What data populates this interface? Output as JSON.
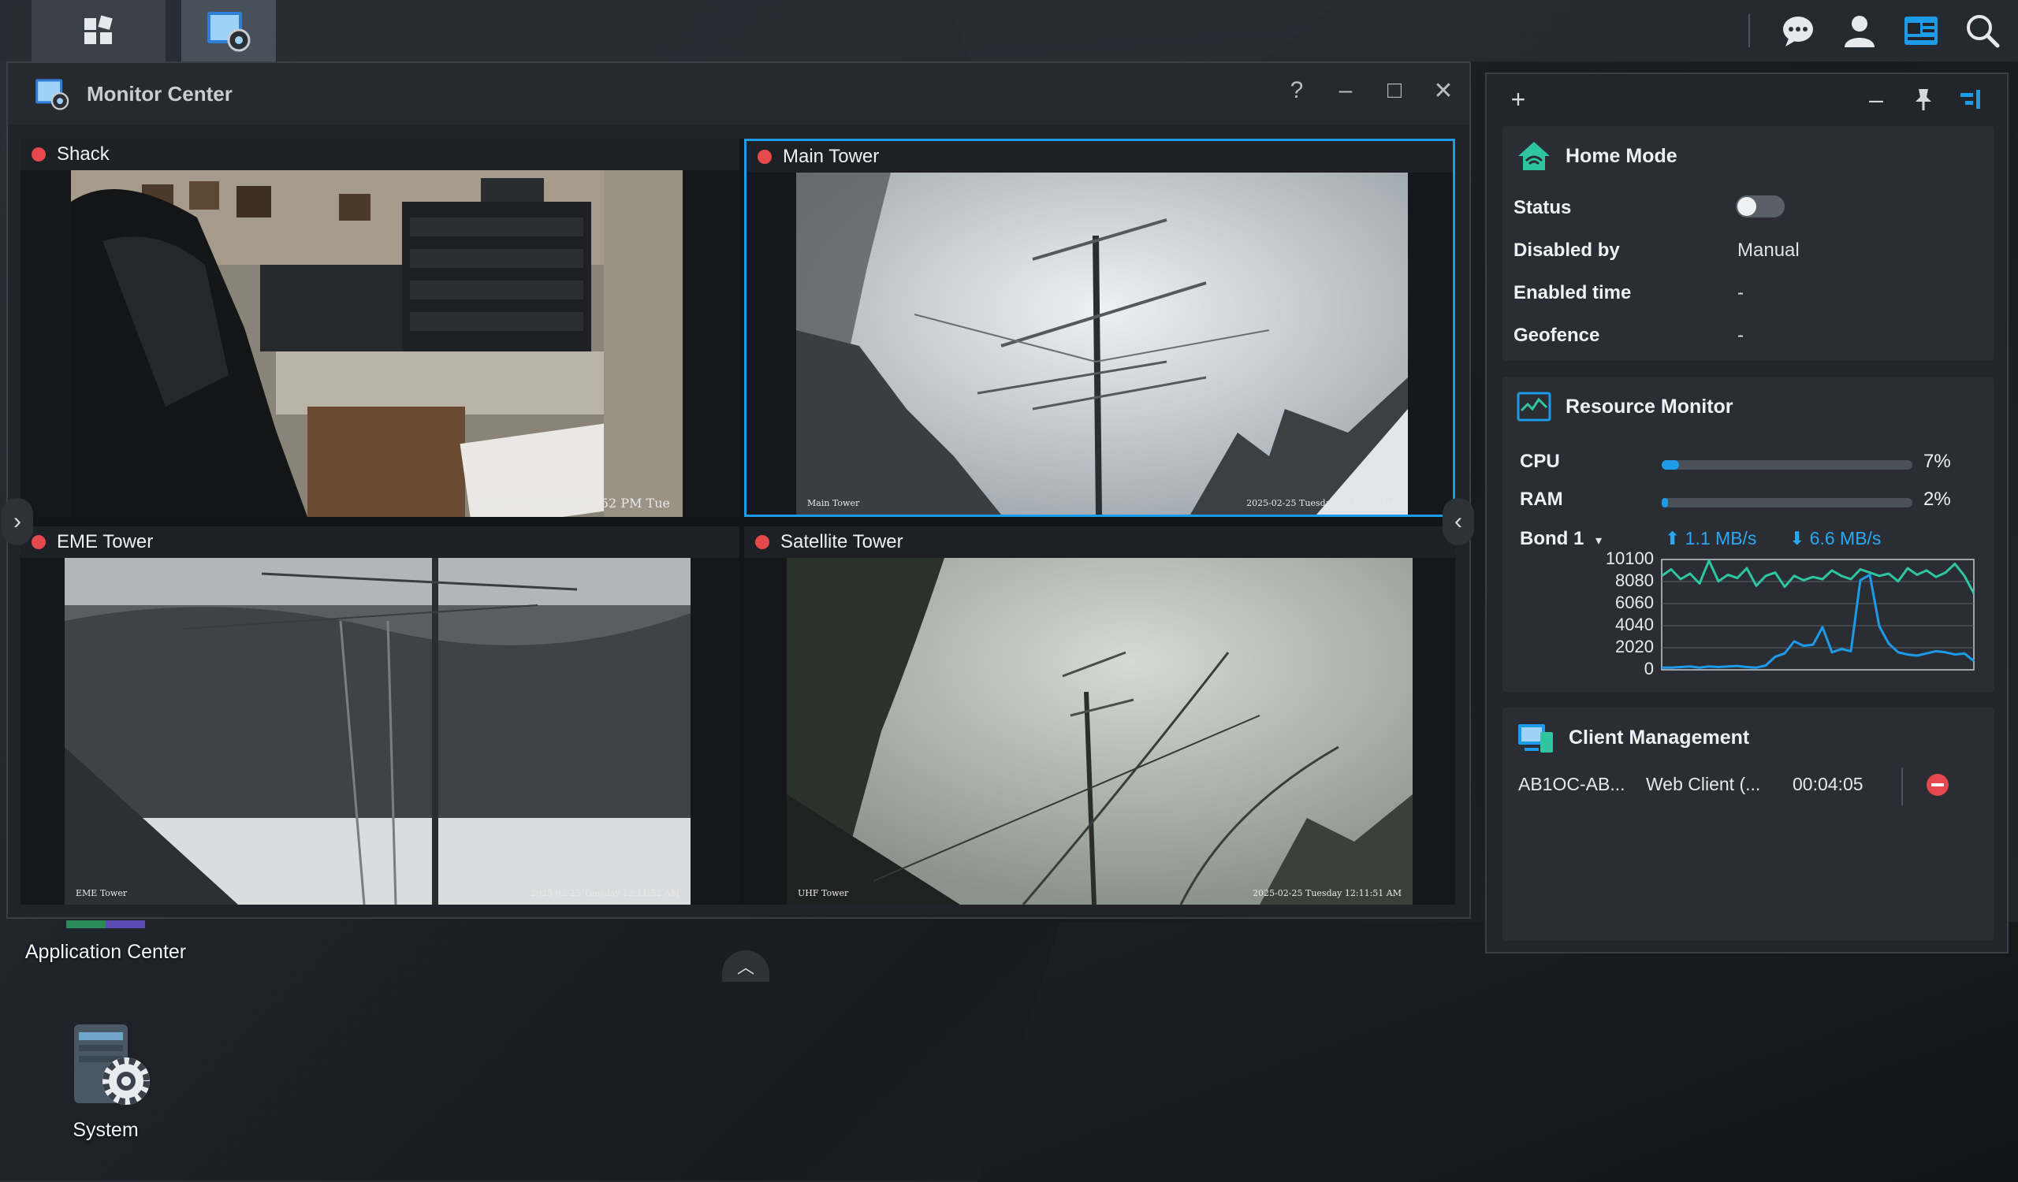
{
  "taskbar": {
    "left_icons": [
      "main-menu-icon",
      "monitor-center-icon"
    ],
    "right_icons": [
      "chat-icon",
      "user-icon",
      "widgets-icon",
      "search-icon"
    ]
  },
  "window": {
    "title": "Monitor Center",
    "controls": {
      "help": "?",
      "minimize": "–",
      "maximize": "□",
      "close": "✕"
    }
  },
  "cameras": [
    {
      "name": "Shack",
      "overlay_left": "",
      "overlay_right": "2025-02-25 12:11:52 PM Tue",
      "selected": false
    },
    {
      "name": "Main Tower",
      "overlay_left": "Main Tower",
      "overlay_right": "2025-02-25 Tuesday 12:11:48 AM",
      "selected": true
    },
    {
      "name": "EME Tower",
      "overlay_left": "EME Tower",
      "overlay_right": "2025-02-25 Tuesday 12:11:52 AM",
      "selected": false
    },
    {
      "name": "Satellite Tower",
      "overlay_left": "UHF Tower",
      "overlay_right": "2025-02-25 Tuesday 12:11:51 AM",
      "selected": false
    }
  ],
  "desktop": {
    "icons": [
      {
        "label": "Application Center",
        "icon": "application-center-icon"
      },
      {
        "label": "System",
        "icon": "system-gear-icon"
      }
    ]
  },
  "panel": {
    "home_mode": {
      "title": "Home Mode",
      "rows": [
        {
          "label": "Status",
          "value": ""
        },
        {
          "label": "Disabled by",
          "value": "Manual"
        },
        {
          "label": "Enabled time",
          "value": "-"
        },
        {
          "label": "Geofence",
          "value": "-"
        }
      ],
      "status_enabled": false
    },
    "resource_monitor": {
      "title": "Resource Monitor",
      "cpu_label": "CPU",
      "cpu_value": "7%",
      "cpu_fraction": 0.07,
      "ram_label": "RAM",
      "ram_value": "2%",
      "ram_fraction": 0.02,
      "net_label": "Bond 1",
      "upload": "1.1 MB/s",
      "download": "6.6 MB/s",
      "colors": {
        "upload": "#2ec5a0",
        "download": "#1e9be8"
      }
    },
    "client_management": {
      "title": "Client Management",
      "clients": [
        {
          "name": "AB1OC-AB...",
          "type": "Web Client (...",
          "duration": "00:04:05"
        }
      ]
    }
  },
  "chart_data": {
    "type": "line",
    "yticks": [
      "10100",
      "8080",
      "6060",
      "4040",
      "2020",
      "0"
    ],
    "ylim": [
      0,
      10100
    ],
    "grid": true,
    "series": [
      {
        "values": [
          8600,
          9200,
          8300,
          8800,
          7900,
          10000,
          8100,
          8700,
          8400,
          9300,
          7700,
          8600,
          8900,
          7600,
          8600,
          8200,
          8500,
          8300,
          9100,
          8600,
          8300,
          9200,
          8900,
          8600,
          8800,
          8100,
          9300,
          8700,
          9100,
          8500,
          8900,
          9700,
          8600,
          7000
        ]
      },
      {
        "values": [
          200,
          200,
          250,
          300,
          200,
          300,
          250,
          300,
          350,
          250,
          200,
          400,
          1200,
          1500,
          2600,
          2200,
          2300,
          3900,
          1600,
          1900,
          1700,
          8200,
          8700,
          4000,
          2400,
          1600,
          1400,
          1300,
          1500,
          1700,
          1600,
          1400,
          1500,
          800
        ]
      }
    ]
  }
}
